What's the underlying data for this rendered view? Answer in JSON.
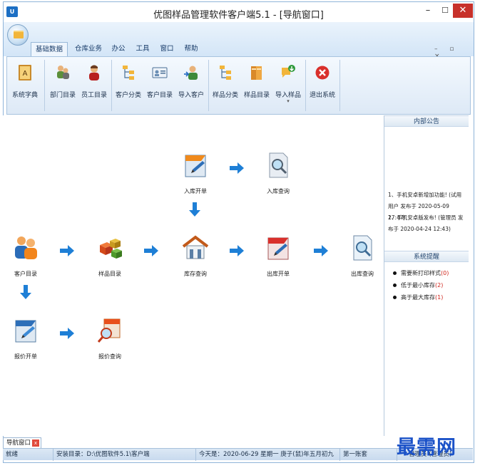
{
  "window": {
    "badge": "U",
    "title": "优图样品管理软件客户端5.1 - [导航窗口]",
    "min_glyph": "–",
    "max_glyph": "☐",
    "close_glyph": "✕"
  },
  "tabs": [
    {
      "label": "基础数据",
      "active": true
    },
    {
      "label": "仓库业务",
      "active": false
    },
    {
      "label": "办公",
      "active": false
    },
    {
      "label": "工具",
      "active": false
    },
    {
      "label": "窗口",
      "active": false
    },
    {
      "label": "帮助",
      "active": false
    }
  ],
  "ribbon_controls": "– ▫ ×",
  "ribbon": {
    "dict": "系统字典",
    "dept": "部门目录",
    "staff": "员工目录",
    "cust_class": "客户分类",
    "cust_dir": "客户目录",
    "cust_import": "导入客户",
    "sample_class": "样品分类",
    "sample_dir": "样品目录",
    "sample_import": "导入样品",
    "dropdown_glyph": "▾",
    "exit": "退出系统"
  },
  "flow": {
    "stock_in": "入库开单",
    "stock_in_query": "入库查询",
    "customer": "客户目录",
    "sample": "样品目录",
    "inventory": "库存查询",
    "stock_out": "出库开单",
    "stock_out_query": "出库查询",
    "quote": "报价开单",
    "quote_query": "报价查询"
  },
  "side": {
    "notice_title": "内部公告",
    "notices": [
      "1、手机安卓新增加功能! (试用用户 发布于 2020-05-09 17:47)",
      "2、手机安卓版发布! (管理员 发布于 2020-04-24 12:43)"
    ],
    "reminder_title": "系统提醒",
    "reminders": [
      {
        "label": "需要新打印样式",
        "count": "(0)"
      },
      {
        "label": "低于最小库存",
        "count": "(2)"
      },
      {
        "label": "高于最大库存",
        "count": "(1)"
      }
    ]
  },
  "doc_tab": {
    "label": "导航窗口",
    "close": "x"
  },
  "status": {
    "ready": "就绪",
    "install_dir": "安装目录：D:\\优图软件5.1\\客户端",
    "today": "今天是：2020-06-29 星期一 庚子(鼠)年五月初九",
    "account": "第一账套",
    "user": "管理员 (管理员)"
  },
  "watermark": "最需网",
  "colors": {
    "accent": "#1c6fc4",
    "arrow": "#1e7fd6",
    "alert": "#d0261c"
  }
}
